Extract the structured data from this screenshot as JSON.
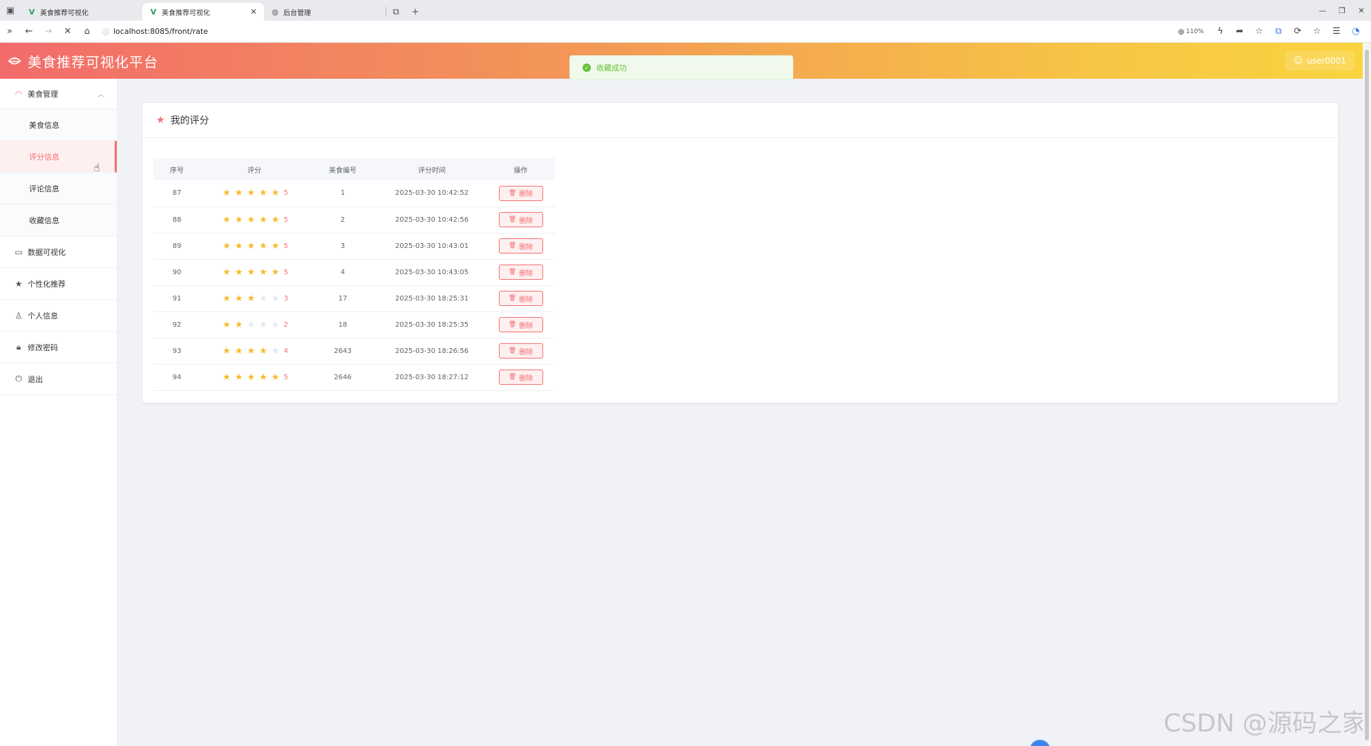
{
  "browser": {
    "tabs": [
      {
        "title": "美食推荐可视化",
        "active": false
      },
      {
        "title": "美食推荐可视化",
        "active": true
      },
      {
        "title": "后台管理",
        "active": false
      }
    ],
    "url": "localhost:8085/front/rate",
    "zoom": "110%"
  },
  "header": {
    "title": "美食推荐可视化平台",
    "user": "user0001"
  },
  "toast": {
    "message": "收藏成功"
  },
  "sidebar": {
    "group": {
      "label": "美食管理",
      "expanded": true
    },
    "sub_items": [
      {
        "label": "美食信息",
        "active": false
      },
      {
        "label": "评分信息",
        "active": true
      },
      {
        "label": "评论信息",
        "active": false
      },
      {
        "label": "收藏信息",
        "active": false
      }
    ],
    "items": [
      {
        "label": "数据可视化",
        "icon": "chart-icon"
      },
      {
        "label": "个性化推荐",
        "icon": "star-icon"
      },
      {
        "label": "个人信息",
        "icon": "user-icon"
      },
      {
        "label": "修改密码",
        "icon": "lock-icon"
      },
      {
        "label": "退出",
        "icon": "power-icon"
      }
    ]
  },
  "card": {
    "title": "我的评分"
  },
  "table": {
    "headers": {
      "id": "序号",
      "score": "评分",
      "food": "美食编号",
      "time": "评分时间",
      "op": "操作"
    },
    "delete_label": "删除",
    "rows": [
      {
        "id": "87",
        "score": 5,
        "score_text": "5",
        "food": "1",
        "time": "2025-03-30 10:42:52"
      },
      {
        "id": "88",
        "score": 5,
        "score_text": "5",
        "food": "2",
        "time": "2025-03-30 10:42:56"
      },
      {
        "id": "89",
        "score": 5,
        "score_text": "5",
        "food": "3",
        "time": "2025-03-30 10:43:01"
      },
      {
        "id": "90",
        "score": 5,
        "score_text": "5",
        "food": "4",
        "time": "2025-03-30 10:43:05"
      },
      {
        "id": "91",
        "score": 3,
        "score_text": "3",
        "food": "17",
        "time": "2025-03-30 18:25:31"
      },
      {
        "id": "92",
        "score": 2,
        "score_text": "2",
        "food": "18",
        "time": "2025-03-30 18:25:35"
      },
      {
        "id": "93",
        "score": 4,
        "score_text": "4",
        "food": "2643",
        "time": "2025-03-30 18:26:56"
      },
      {
        "id": "94",
        "score": 5,
        "score_text": "5",
        "food": "2646",
        "time": "2025-03-30 18:27:12"
      }
    ]
  },
  "watermark": "CSDN @源码之家",
  "colors": {
    "accent": "#f56c6c",
    "star_on": "#f7ba2a",
    "header_start": "#f26b6b",
    "header_end": "#f9d43f",
    "success": "#67c23a"
  }
}
